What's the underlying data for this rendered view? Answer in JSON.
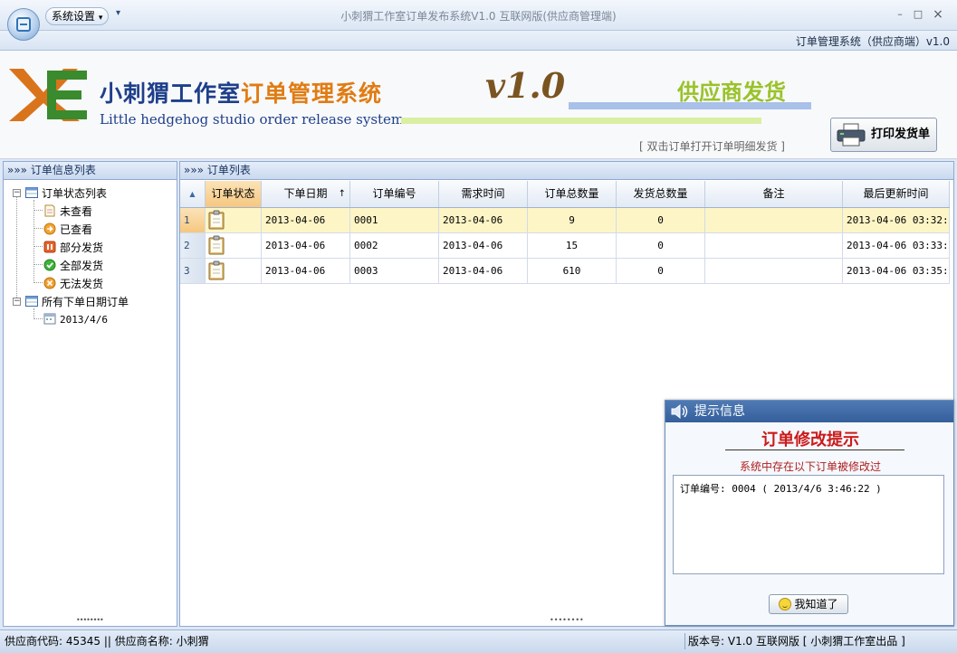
{
  "titlebar": {
    "sys_menu_label": "系统设置",
    "sys_menu_arrow": "▾",
    "quick_access_arrow": "▾",
    "window_title": "小刺猬工作室订单发布系统V1.0 互联网版(供应商管理端)",
    "ribbon_right": "订单管理系统（供应商端）v1.0",
    "minimize": "–",
    "maximize": "□",
    "close": "×"
  },
  "banner": {
    "cn_title_a": "小刺猬工作室",
    "cn_title_b": "订单管理系统",
    "en_title": "Little hedgehog studio order release system",
    "version_mark": "v1.0",
    "supplier_ship": "供应商发货",
    "hint": "[ 双击订单打开订单明细发货 ]",
    "print_button": "打印发货单"
  },
  "left_panel": {
    "header": "»»» 订单信息列表",
    "tree": {
      "root1": "订单状态列表",
      "status_items": [
        "未查看",
        "已查看",
        "部分发货",
        "全部发货",
        "无法发货"
      ],
      "root2": "所有下单日期订单",
      "date_item": "2013/4/6"
    },
    "grip": "••••••••"
  },
  "main_panel": {
    "header": "»»» 订单列表",
    "columns": [
      "订单状态",
      "下单日期",
      "订单编号",
      "需求时间",
      "订单总数量",
      "发货总数量",
      "备注",
      "最后更新时间"
    ],
    "sort_indicator": "↑",
    "corner_icon": "▲",
    "rows": [
      {
        "num": "1",
        "date": "2013-04-06",
        "order_no": "0001",
        "need_time": "2013-04-06",
        "total_qty": "9",
        "shipped_qty": "0",
        "remark": "",
        "updated": "2013-04-06 03:32:"
      },
      {
        "num": "2",
        "date": "2013-04-06",
        "order_no": "0002",
        "need_time": "2013-04-06",
        "total_qty": "15",
        "shipped_qty": "0",
        "remark": "",
        "updated": "2013-04-06 03:33:"
      },
      {
        "num": "3",
        "date": "2013-04-06",
        "order_no": "0003",
        "need_time": "2013-04-06",
        "total_qty": "610",
        "shipped_qty": "0",
        "remark": "",
        "updated": "2013-04-06 03:35:"
      }
    ],
    "grip": "••••••••"
  },
  "statusbar": {
    "left": "供应商代码: 45345 || 供应商名称: 小刺猬",
    "right": "版本号: V1.0 互联网版 [ 小刺猬工作室出品 ]"
  },
  "popup": {
    "header": "提示信息",
    "title": "订单修改提示",
    "subtitle": "系统中存在以下订单被修改过",
    "content": "订单编号: 0004 ( 2013/4/6 3:46:22 )",
    "button": "我知道了"
  },
  "colors": {
    "brand_blue": "#1e3f8a",
    "brand_orange": "#e07c13",
    "ship_green": "#9ac22a",
    "alert_red": "#cc1a1a",
    "selected_row": "#fdf5c6"
  }
}
